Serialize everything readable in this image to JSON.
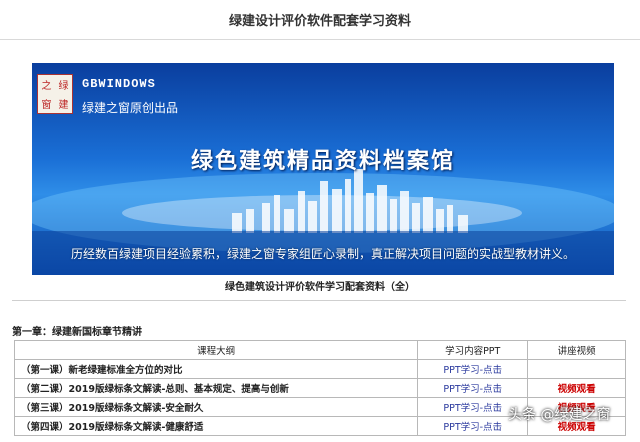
{
  "page_title": "绿建设计评价软件配套学习资料",
  "banner": {
    "logo_chars": [
      "之",
      "绿",
      "窗",
      "建"
    ],
    "brand_en": "GBWINDOWS",
    "brand_cn": "绿建之窗原创出品",
    "headline": "绿色建筑精品资料档案馆",
    "tagline": "历经数百绿建项目经验累积，绿建之窗专家组匠心录制，真正解决项目问题的实战型教材讲义。",
    "colors": {
      "top": "#0a3e9e",
      "mid": "#2f8ee8",
      "bottom": "#0b4fb4"
    }
  },
  "caption": "绿色建筑设计评价软件学习配套资料（全）",
  "chapter_title": "第一章：绿建新国标章节精讲",
  "table": {
    "headers": [
      "课程大纲",
      "学习内容PPT",
      "讲座视频"
    ],
    "rows": [
      {
        "lesson": "（第一课）新老绿建标准全方位的对比",
        "ppt": "PPT学习-点击",
        "video": ""
      },
      {
        "lesson": "（第二课）2019版绿标条文解读-总则、基本规定、提高与创新",
        "ppt": "PPT学习-点击",
        "video": "视频观看"
      },
      {
        "lesson": "（第三课）2019版绿标条文解读-安全耐久",
        "ppt": "PPT学习-点击",
        "video": "视频观看"
      },
      {
        "lesson": "（第四课）2019版绿标条文解读-健康舒适",
        "ppt": "PPT学习-点击",
        "video": "视频观看"
      }
    ]
  },
  "watermark": "头条 @绿建之窗"
}
